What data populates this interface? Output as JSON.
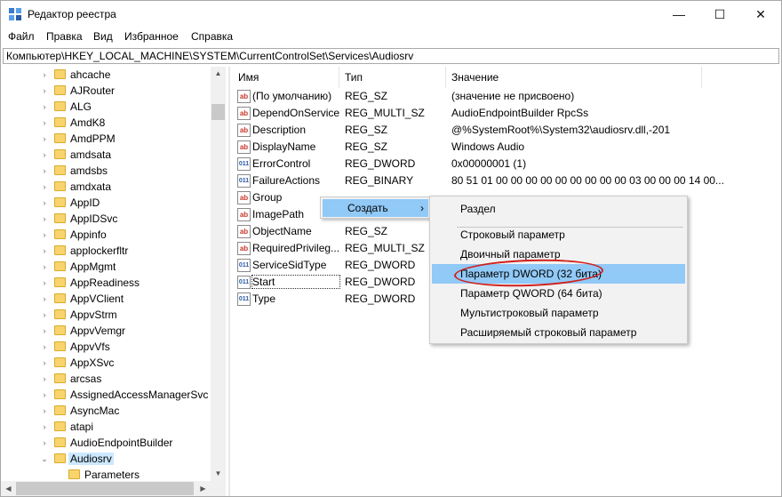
{
  "window": {
    "title": "Редактор реестра",
    "controls": {
      "minimize": "—",
      "maximize": "☐",
      "close": "✕"
    }
  },
  "menu": [
    "Файл",
    "Правка",
    "Вид",
    "Избранное",
    "Справка"
  ],
  "address": "Компьютер\\HKEY_LOCAL_MACHINE\\SYSTEM\\CurrentControlSet\\Services\\Audiosrv",
  "tree": {
    "items": [
      {
        "label": "ahcache"
      },
      {
        "label": "AJRouter"
      },
      {
        "label": "ALG"
      },
      {
        "label": "AmdK8"
      },
      {
        "label": "AmdPPM"
      },
      {
        "label": "amdsata"
      },
      {
        "label": "amdsbs"
      },
      {
        "label": "amdxata"
      },
      {
        "label": "AppID"
      },
      {
        "label": "AppIDSvc"
      },
      {
        "label": "Appinfo"
      },
      {
        "label": "applockerfltr"
      },
      {
        "label": "AppMgmt"
      },
      {
        "label": "AppReadiness"
      },
      {
        "label": "AppVClient"
      },
      {
        "label": "AppvStrm"
      },
      {
        "label": "AppvVemgr"
      },
      {
        "label": "AppvVfs"
      },
      {
        "label": "AppXSvc"
      },
      {
        "label": "arcsas"
      },
      {
        "label": "AssignedAccessManagerSvc"
      },
      {
        "label": "AsyncMac"
      },
      {
        "label": "atapi"
      },
      {
        "label": "AudioEndpointBuilder"
      },
      {
        "label": "Audiosrv"
      },
      {
        "label": "Parameters"
      }
    ]
  },
  "columns": {
    "name": "Имя",
    "type": "Тип",
    "data": "Значение"
  },
  "values": [
    {
      "icon": "ab",
      "name": "(По умолчанию)",
      "type": "REG_SZ",
      "data": "(значение не присвоено)"
    },
    {
      "icon": "ab",
      "name": "DependOnService",
      "type": "REG_MULTI_SZ",
      "data": "AudioEndpointBuilder RpcSs"
    },
    {
      "icon": "ab",
      "name": "Description",
      "type": "REG_SZ",
      "data": "@%SystemRoot%\\System32\\audiosrv.dll,-201"
    },
    {
      "icon": "ab",
      "name": "DisplayName",
      "type": "REG_SZ",
      "data": "Windows Audio"
    },
    {
      "icon": "dw",
      "name": "ErrorControl",
      "type": "REG_DWORD",
      "data": "0x00000001 (1)"
    },
    {
      "icon": "dw",
      "name": "FailureActions",
      "type": "REG_BINARY",
      "data": "80 51 01 00 00 00 00 00 00 00 00 00 03 00 00 00 14 00..."
    },
    {
      "icon": "ab",
      "name": "Group",
      "type": "",
      "data": ""
    },
    {
      "icon": "ab",
      "name": "ImagePath",
      "type": "",
      "data": ""
    },
    {
      "icon": "ab",
      "name": "ObjectName",
      "type": "REG_SZ",
      "data": ""
    },
    {
      "icon": "ab",
      "name": "RequiredPrivileg...",
      "type": "REG_MULTI_SZ",
      "data": ""
    },
    {
      "icon": "dw",
      "name": "ServiceSidType",
      "type": "REG_DWORD",
      "data": ""
    },
    {
      "icon": "dw",
      "name": "Start",
      "type": "REG_DWORD",
      "data": ""
    },
    {
      "icon": "dw",
      "name": "Type",
      "type": "REG_DWORD",
      "data": ""
    }
  ],
  "context_menu": {
    "create_label": "Создать",
    "create_arrow": "›"
  },
  "submenu": {
    "items": [
      "Раздел",
      "Строковый параметр",
      "Двоичный параметр",
      "Параметр DWORD (32 бита)",
      "Параметр QWORD (64 бита)",
      "Мультистроковый параметр",
      "Расширяемый строковый параметр"
    ]
  },
  "colors": {
    "highlight": "#91c9f7",
    "annotation": "#d0201c",
    "folder": "#f8d46c"
  }
}
